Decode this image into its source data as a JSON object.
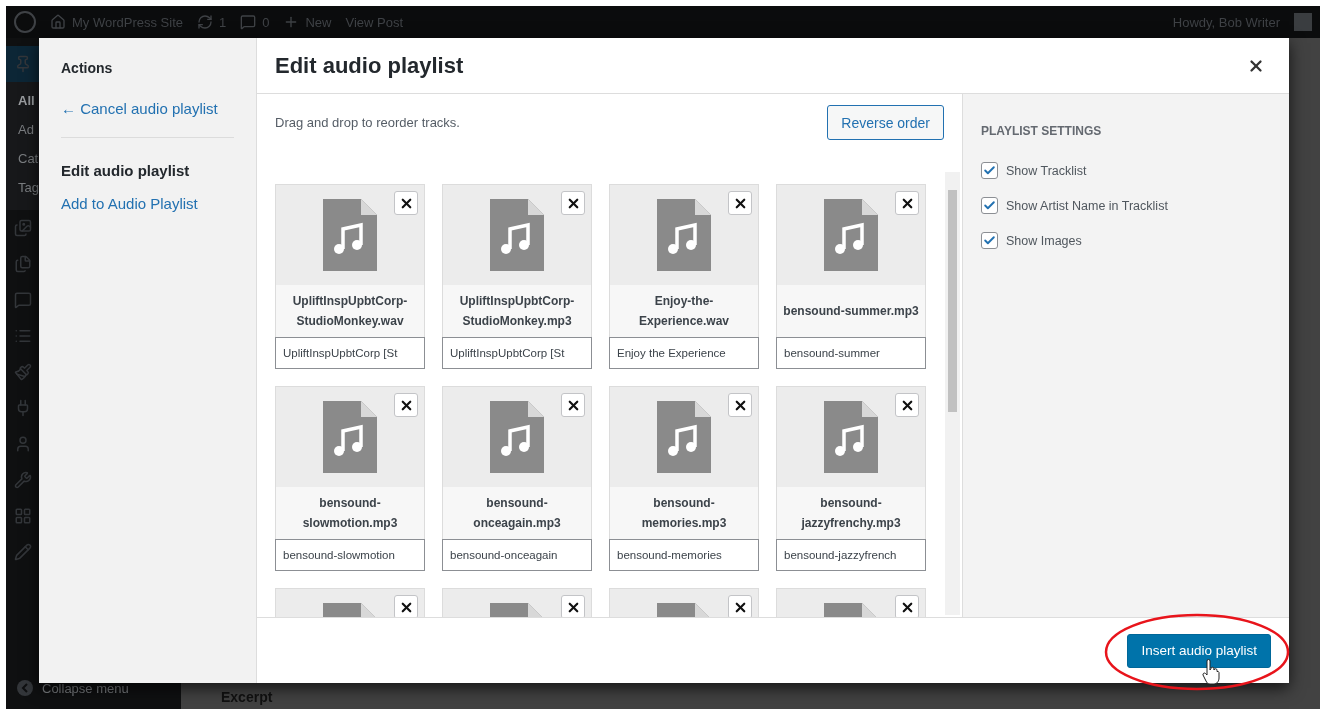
{
  "admin_bar": {
    "site": "My WordPress Site",
    "updates": "1",
    "comments": "0",
    "new": "New",
    "view": "View Post",
    "greeting": "Howdy, Bob Writer"
  },
  "admin_menu": {
    "submenu": [
      {
        "label": "All",
        "selected": true
      },
      {
        "label": "Ad",
        "selected": false
      },
      {
        "label": "Cat",
        "selected": false
      },
      {
        "label": "Tag",
        "selected": false
      }
    ],
    "collapse": "Collapse menu"
  },
  "editor": {
    "section": "Excerpt"
  },
  "modal": {
    "menu": {
      "heading": "Actions",
      "cancel": "← Cancel audio playlist",
      "items": [
        {
          "label": "Edit audio playlist",
          "selected": true
        },
        {
          "label": "Add to Audio Playlist",
          "selected": false
        }
      ]
    },
    "title": "Edit audio playlist",
    "toolbar": {
      "hint": "Drag and drop to reorder tracks.",
      "reverse": "Reverse order"
    },
    "tracks": [
      {
        "kind": "full",
        "title": "UpliftInspUpbtCorp-StudioMonkey.wav",
        "caption": "UpliftInspUpbtCorp [St"
      },
      {
        "kind": "full",
        "title": "UpliftInspUpbtCorp-StudioMonkey.mp3",
        "caption": "UpliftInspUpbtCorp [St"
      },
      {
        "kind": "full",
        "title": "Enjoy-the-Experience.wav",
        "caption": "Enjoy the Experience"
      },
      {
        "kind": "full",
        "title": "bensound-summer.mp3",
        "caption": "bensound-summer"
      },
      {
        "kind": "full",
        "title": "bensound-slowmotion.mp3",
        "caption": "bensound-slowmotion"
      },
      {
        "kind": "full",
        "title": "bensound-onceagain.mp3",
        "caption": "bensound-onceagain"
      },
      {
        "kind": "full",
        "title": "bensound-memories.mp3",
        "caption": "bensound-memories"
      },
      {
        "kind": "full",
        "title": "bensound-jazzyfrenchy.mp3",
        "caption": "bensound-jazzyfrench"
      },
      {
        "kind": "partial"
      },
      {
        "kind": "partial"
      },
      {
        "kind": "partial"
      },
      {
        "kind": "partial"
      }
    ],
    "settings": {
      "heading": "PLAYLIST SETTINGS",
      "options": [
        {
          "label": "Show Tracklist",
          "checked": true
        },
        {
          "label": "Show Artist Name in Tracklist",
          "checked": true
        },
        {
          "label": "Show Images",
          "checked": true
        }
      ]
    },
    "insert": "Insert audio playlist"
  }
}
